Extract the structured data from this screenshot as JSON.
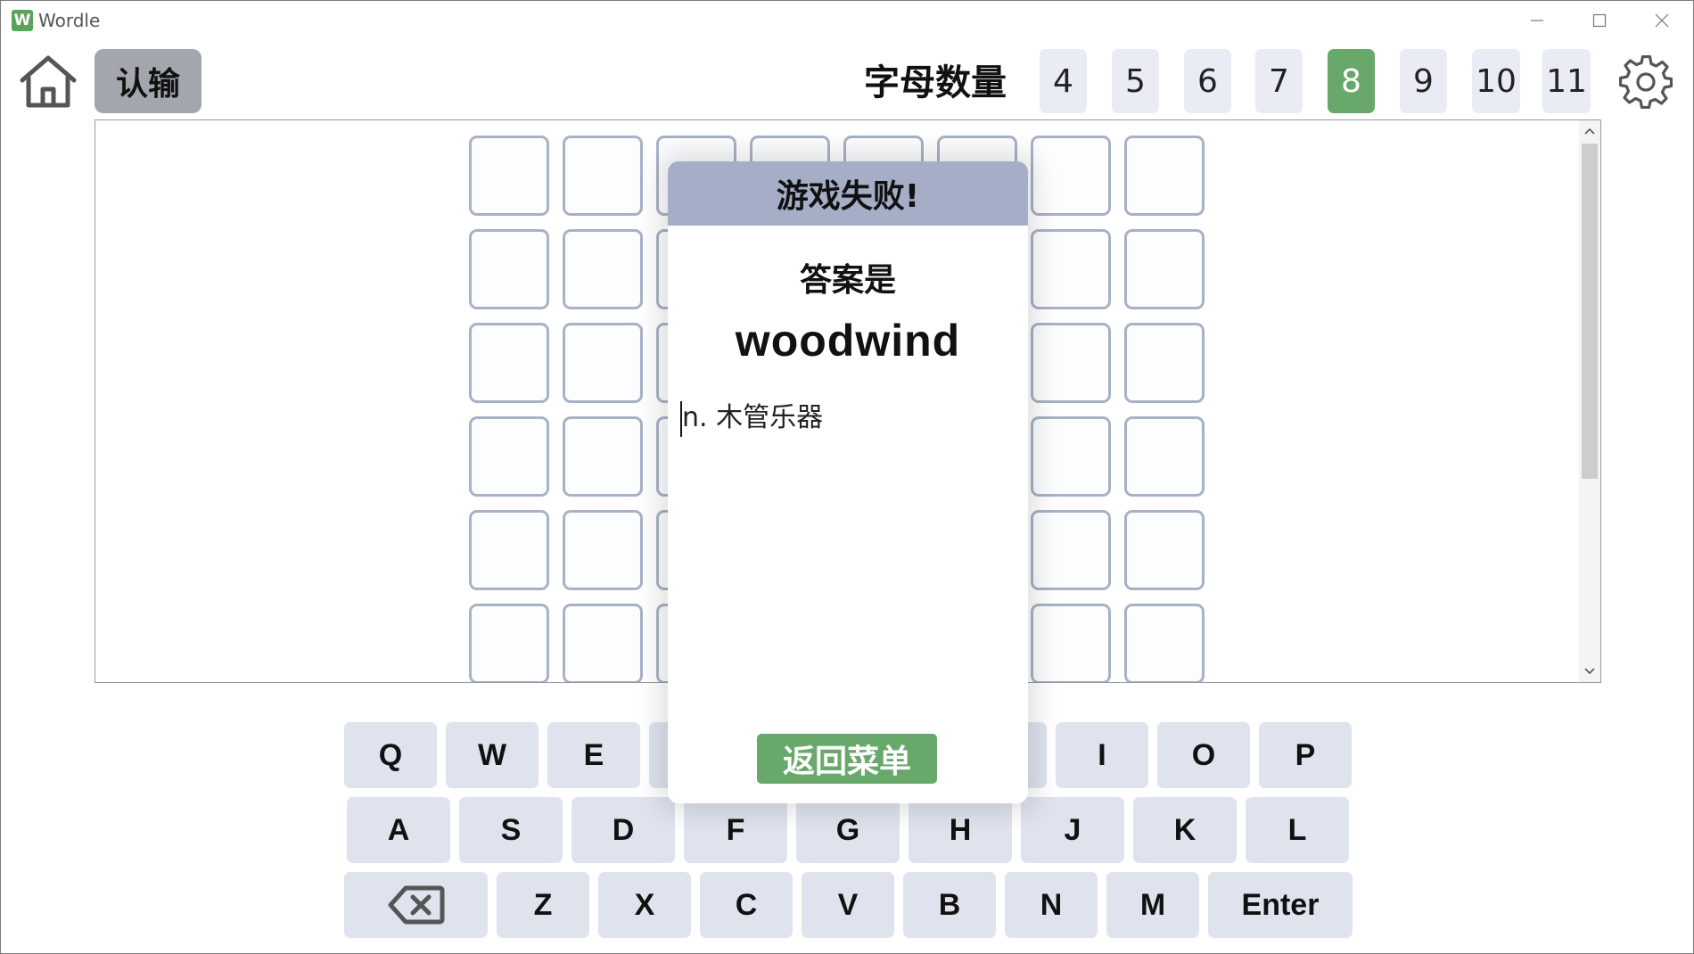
{
  "window": {
    "app_icon_letter": "W",
    "title": "Wordle"
  },
  "toolbar": {
    "home_icon": "home-icon",
    "give_up_label": "认输",
    "letter_count_label": "字母数量",
    "lengths": [
      "4",
      "5",
      "6",
      "7",
      "8",
      "9",
      "10",
      "11"
    ],
    "selected_length": "8",
    "settings_icon": "gear-icon"
  },
  "board": {
    "rows": 6,
    "columns": 8,
    "cell_border_color": "#a8b1c6"
  },
  "keyboard": {
    "row1": [
      "Q",
      "W",
      "E",
      "R",
      "T",
      "Y",
      "U",
      "I",
      "O",
      "P"
    ],
    "row2": [
      "A",
      "S",
      "D",
      "F",
      "G",
      "H",
      "J",
      "K",
      "L"
    ],
    "row3": [
      "⌫",
      "Z",
      "X",
      "C",
      "V",
      "B",
      "N",
      "M",
      "Enter"
    ],
    "backspace_icon": "backspace-icon"
  },
  "dialog": {
    "title": "游戏失败!",
    "answer_label": "答案是",
    "answer_word": "woodwind",
    "definition": "n. 木管乐器",
    "back_button_label": "返回菜单"
  },
  "colors": {
    "accent_green": "#69a86b",
    "key_bg": "#dfe3ee",
    "length_bg": "#e9ecf5",
    "dialog_header": "#a5aec6",
    "give_up_bg": "#a3a6ad"
  }
}
